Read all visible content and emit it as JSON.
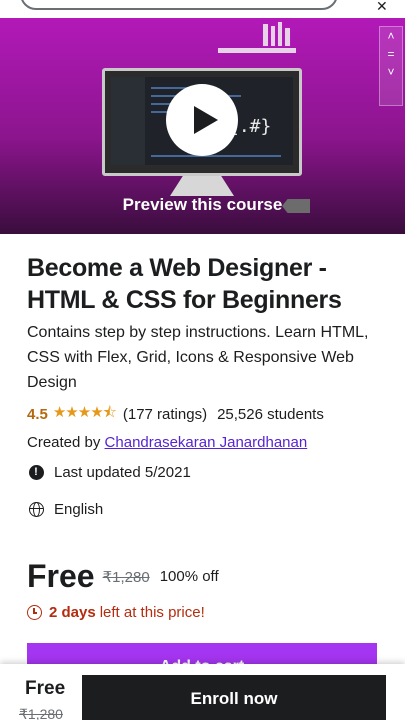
{
  "hero": {
    "preview_label": "Preview this course",
    "braces_text": "{.#}"
  },
  "course": {
    "title": "Become a Web Designer - HTML & CSS for Beginners",
    "description": "Contains step by step instructions. Learn HTML, CSS with Flex, Grid, Icons & Responsive Web Design",
    "rating": "4.5",
    "stars": "★★★★⯪",
    "ratings_count": "(177 ratings)",
    "students": "25,526 students",
    "created_by_label": "Created by",
    "author": "Chandrasekaran Janardhanan",
    "last_updated": "Last updated 5/2021",
    "language": "English"
  },
  "pricing": {
    "price": "Free",
    "original_price": "₹1,280",
    "discount": "100% off",
    "timer_days": "2 days",
    "timer_rest": "left at this price!",
    "add_to_cart_label": "Add to cart"
  },
  "bottom_bar": {
    "price": "Free",
    "original_price": "₹1,280",
    "enroll_label": "Enroll now"
  },
  "colors": {
    "brand_purple": "#a435f0",
    "hero_magenta": "#b219b8",
    "rating_orange": "#b4690e",
    "timer_red": "#b32d0f",
    "link_purple": "#5624d0"
  }
}
